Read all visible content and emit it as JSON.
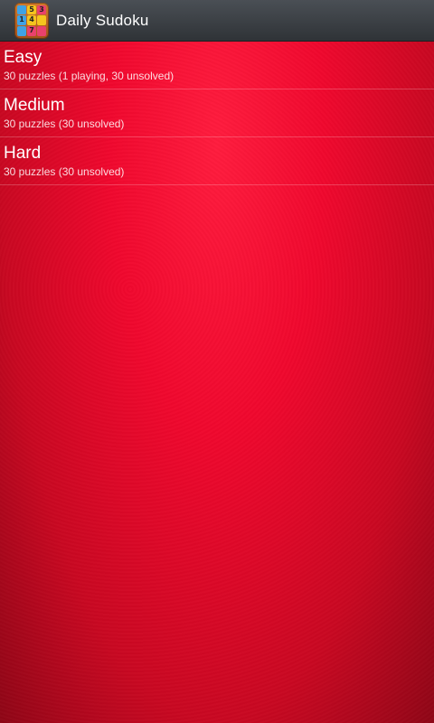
{
  "app": {
    "title": "Daily Sudoku",
    "icon_digits": [
      "",
      "5",
      "3",
      "1",
      "4",
      "",
      "",
      "7",
      ""
    ]
  },
  "colors": {
    "action_bar": "#3a3e43",
    "background": "#e8092a",
    "text": "#ffffff"
  },
  "levels": [
    {
      "title": "Easy",
      "subtitle": "30 puzzles (1 playing, 30 unsolved)"
    },
    {
      "title": "Medium",
      "subtitle": "30 puzzles (30 unsolved)"
    },
    {
      "title": "Hard",
      "subtitle": "30 puzzles (30 unsolved)"
    }
  ]
}
